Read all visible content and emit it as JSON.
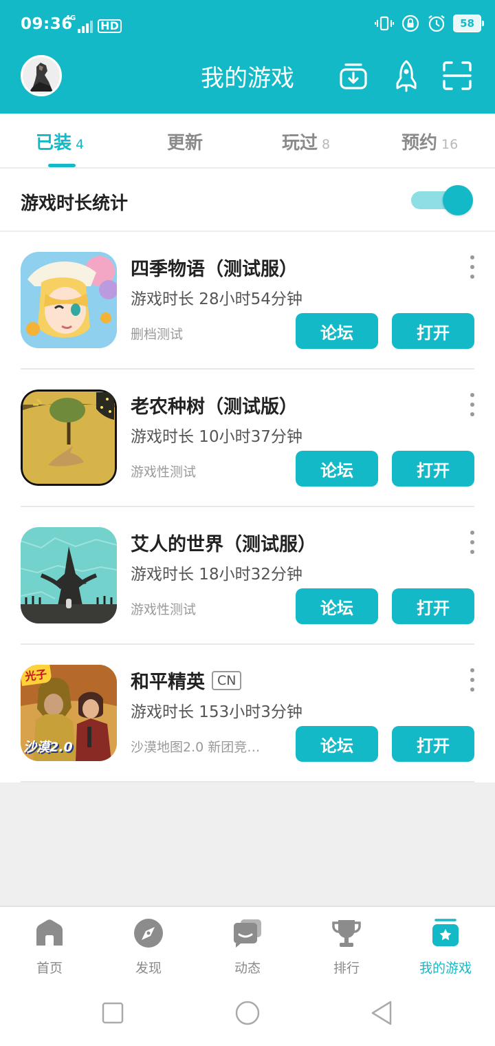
{
  "status": {
    "time": "09:36",
    "network": "4G",
    "hd": "HD",
    "battery": "58"
  },
  "header": {
    "title": "我的游戏"
  },
  "tabs": [
    {
      "label": "已装",
      "count": "4"
    },
    {
      "label": "更新",
      "count": ""
    },
    {
      "label": "玩过",
      "count": "8"
    },
    {
      "label": "预约",
      "count": "16"
    }
  ],
  "stats": {
    "label": "游戏时长统计",
    "enabled": true
  },
  "games": [
    {
      "name": "四季物语（测试服）",
      "tag": "",
      "playtime": "游戏时长 28小时54分钟",
      "sub": "删档测试",
      "forum": "论坛",
      "open": "打开"
    },
    {
      "name": "老农种树（测试版）",
      "tag": "",
      "playtime": "游戏时长 10小时37分钟",
      "sub": "游戏性测试",
      "forum": "论坛",
      "open": "打开"
    },
    {
      "name": "艾人的世界（测试服）",
      "tag": "",
      "playtime": "游戏时长 18小时32分钟",
      "sub": "游戏性测试",
      "forum": "论坛",
      "open": "打开"
    },
    {
      "name": "和平精英",
      "tag": "CN",
      "playtime": "游戏时长 153小时3分钟",
      "sub": "沙漠地图2.0 新团竞…",
      "forum": "论坛",
      "open": "打开",
      "icon_text": [
        "光子",
        "沙漠2.0"
      ]
    }
  ],
  "bottom_nav": [
    {
      "label": "首页",
      "icon": "home-icon"
    },
    {
      "label": "发现",
      "icon": "compass-icon"
    },
    {
      "label": "动态",
      "icon": "chat-icon"
    },
    {
      "label": "排行",
      "icon": "trophy-icon"
    },
    {
      "label": "我的游戏",
      "icon": "my-games-icon"
    }
  ],
  "colors": {
    "accent": "#14b9c8",
    "accent_light": "#8ddee5"
  }
}
